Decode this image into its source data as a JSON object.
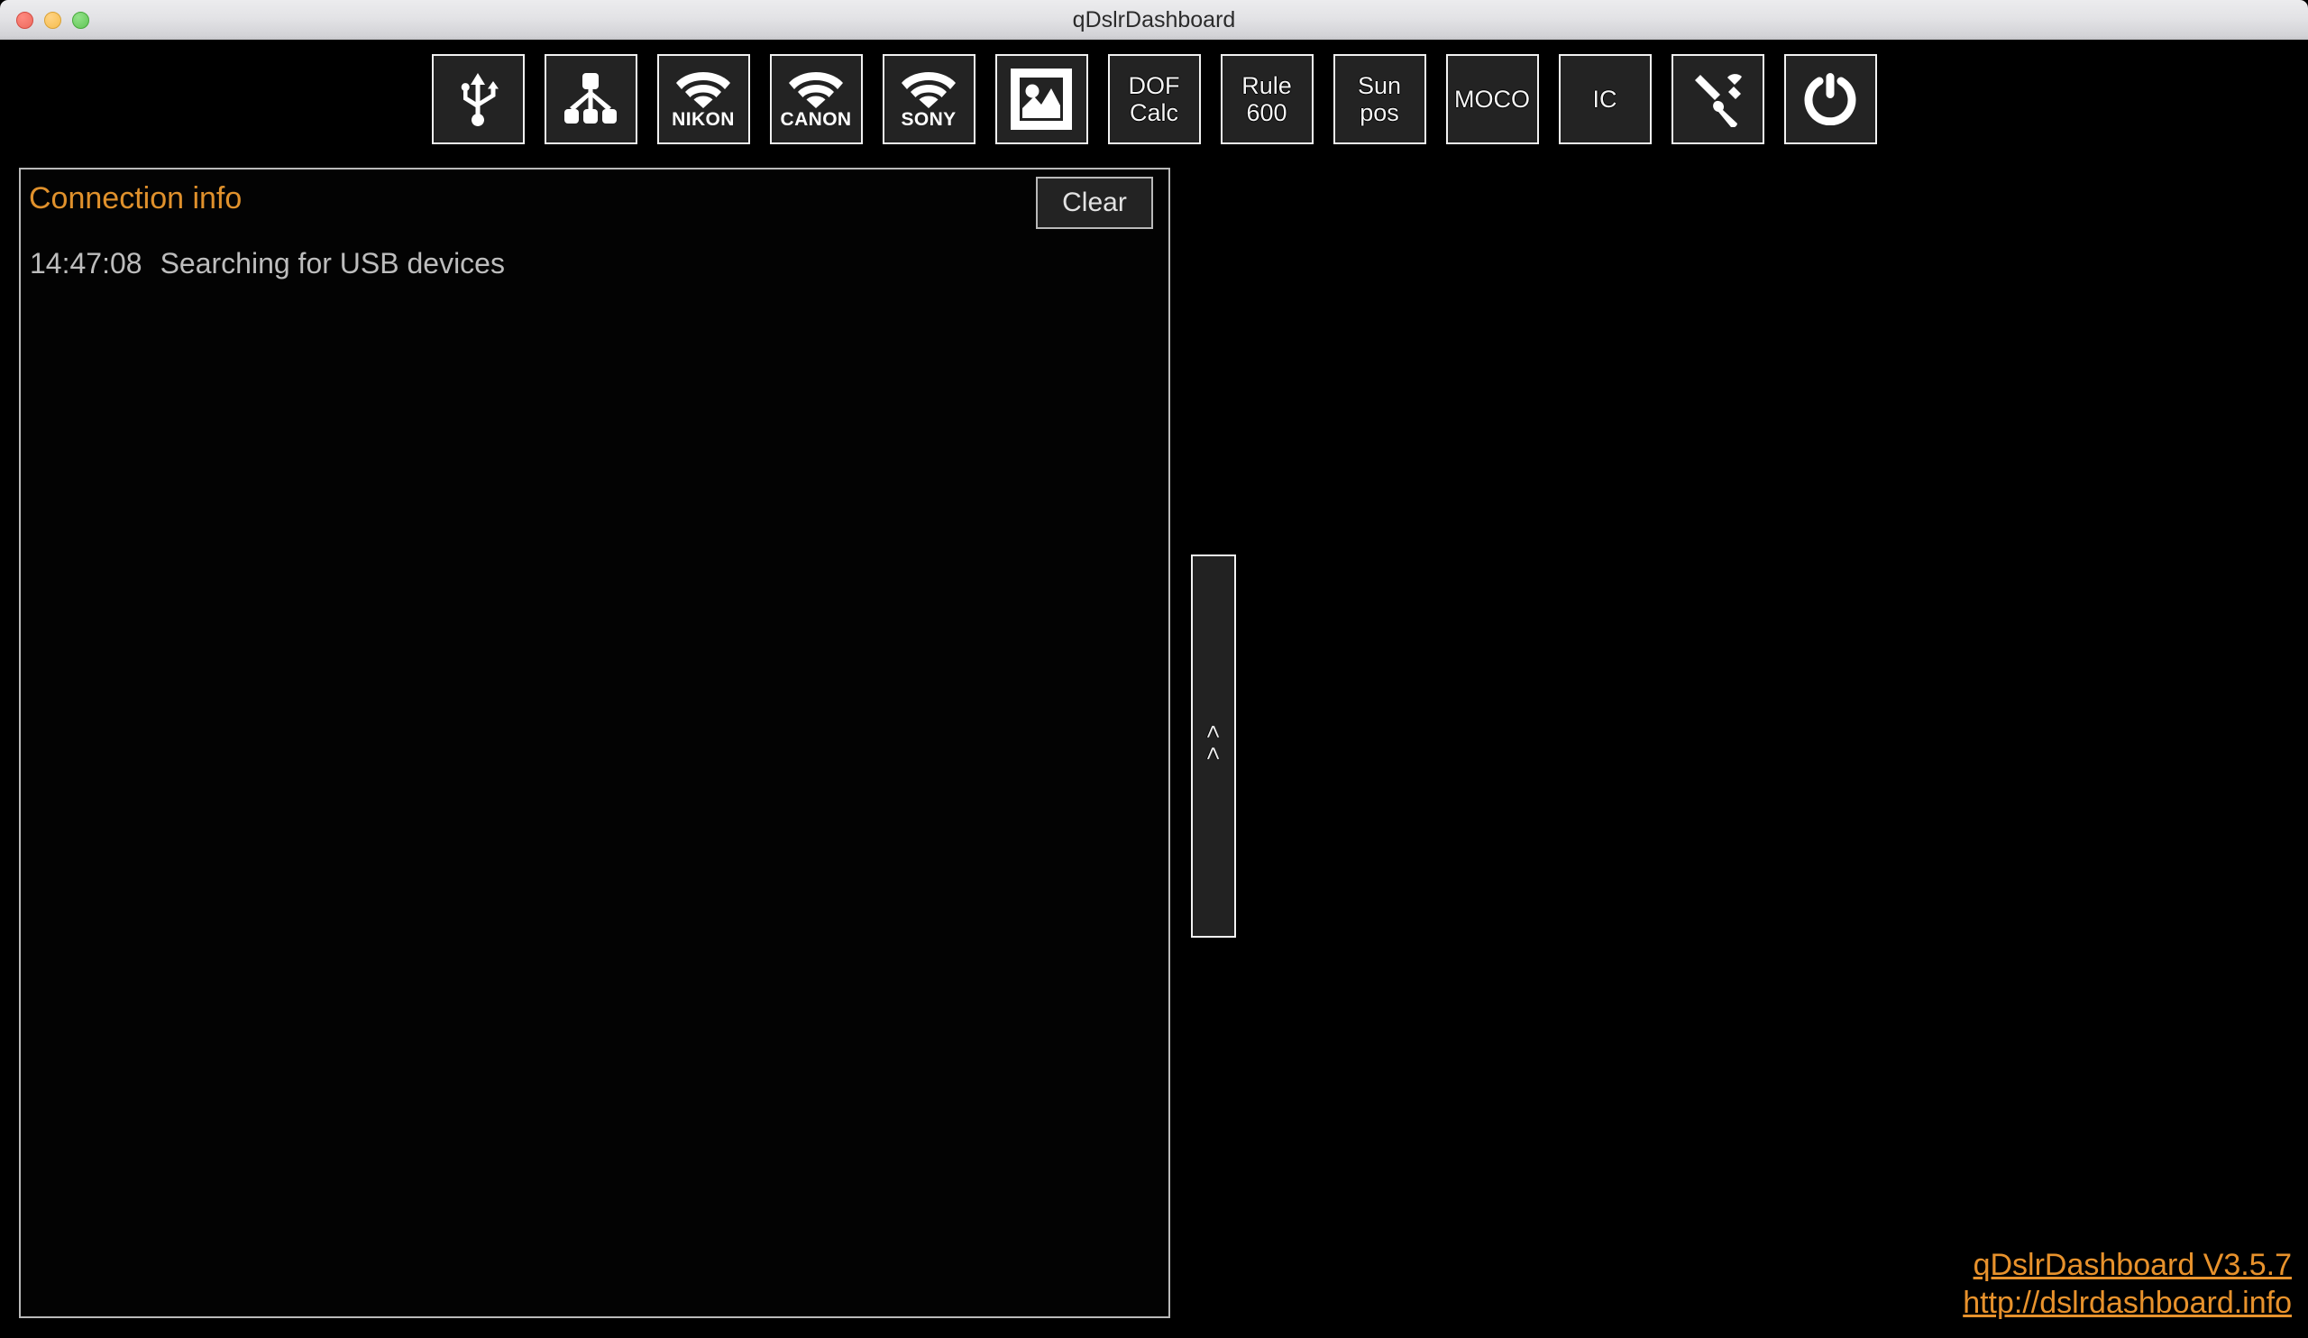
{
  "window": {
    "title": "qDslrDashboard",
    "traffic_lights": [
      "close",
      "minimize",
      "maximize"
    ],
    "colors": {
      "close": "#ec6a5e",
      "minimize": "#f5bd4f",
      "maximize": "#61c555",
      "accent_orange": "#e8922c",
      "panel_border": "#b9b9b9",
      "button_face": "#232323",
      "background": "#000000",
      "log_text": "#bdbdbd"
    }
  },
  "toolbar": {
    "buttons": [
      {
        "id": "usb",
        "icon": "usb-icon",
        "label": "",
        "brand": ""
      },
      {
        "id": "network",
        "icon": "network-hub-icon",
        "label": "",
        "brand": ""
      },
      {
        "id": "nikon",
        "icon": "wifi-icon",
        "label": "",
        "brand": "NIKON"
      },
      {
        "id": "canon",
        "icon": "wifi-icon",
        "label": "",
        "brand": "CANON"
      },
      {
        "id": "sony",
        "icon": "wifi-icon",
        "label": "",
        "brand": "SONY"
      },
      {
        "id": "gallery",
        "icon": "image-icon",
        "label": "",
        "brand": ""
      },
      {
        "id": "dofcalc",
        "icon": "",
        "label": "DOF\nCalc",
        "brand": ""
      },
      {
        "id": "rule600",
        "icon": "",
        "label": "Rule\n600",
        "brand": ""
      },
      {
        "id": "sunpos",
        "icon": "",
        "label": "Sun\npos",
        "brand": ""
      },
      {
        "id": "moco",
        "icon": "",
        "label": "MOCO",
        "brand": ""
      },
      {
        "id": "ic",
        "icon": "",
        "label": "IC",
        "brand": ""
      },
      {
        "id": "tools",
        "icon": "tools-icon",
        "label": "",
        "brand": ""
      },
      {
        "id": "power",
        "icon": "power-icon",
        "label": "",
        "brand": ""
      }
    ],
    "labels": {
      "dofcalc_line1": "DOF",
      "dofcalc_line2": "Calc",
      "rule600_line1": "Rule",
      "rule600_line2": "600",
      "sunpos_line1": "Sun",
      "sunpos_line2": "pos",
      "moco": "MOCO",
      "ic": "IC",
      "nikon": "NIKON",
      "canon": "CANON",
      "sony": "SONY"
    }
  },
  "connection_panel": {
    "title": "Connection info",
    "clear_label": "Clear",
    "log": [
      {
        "time": "14:47:08",
        "message": "Searching for USB devices"
      }
    ]
  },
  "splitter": {
    "chevrons": "<<"
  },
  "footer": {
    "version_link": "qDslrDashboard V3.5.7",
    "site_link": "http://dslrdashboard.info"
  }
}
